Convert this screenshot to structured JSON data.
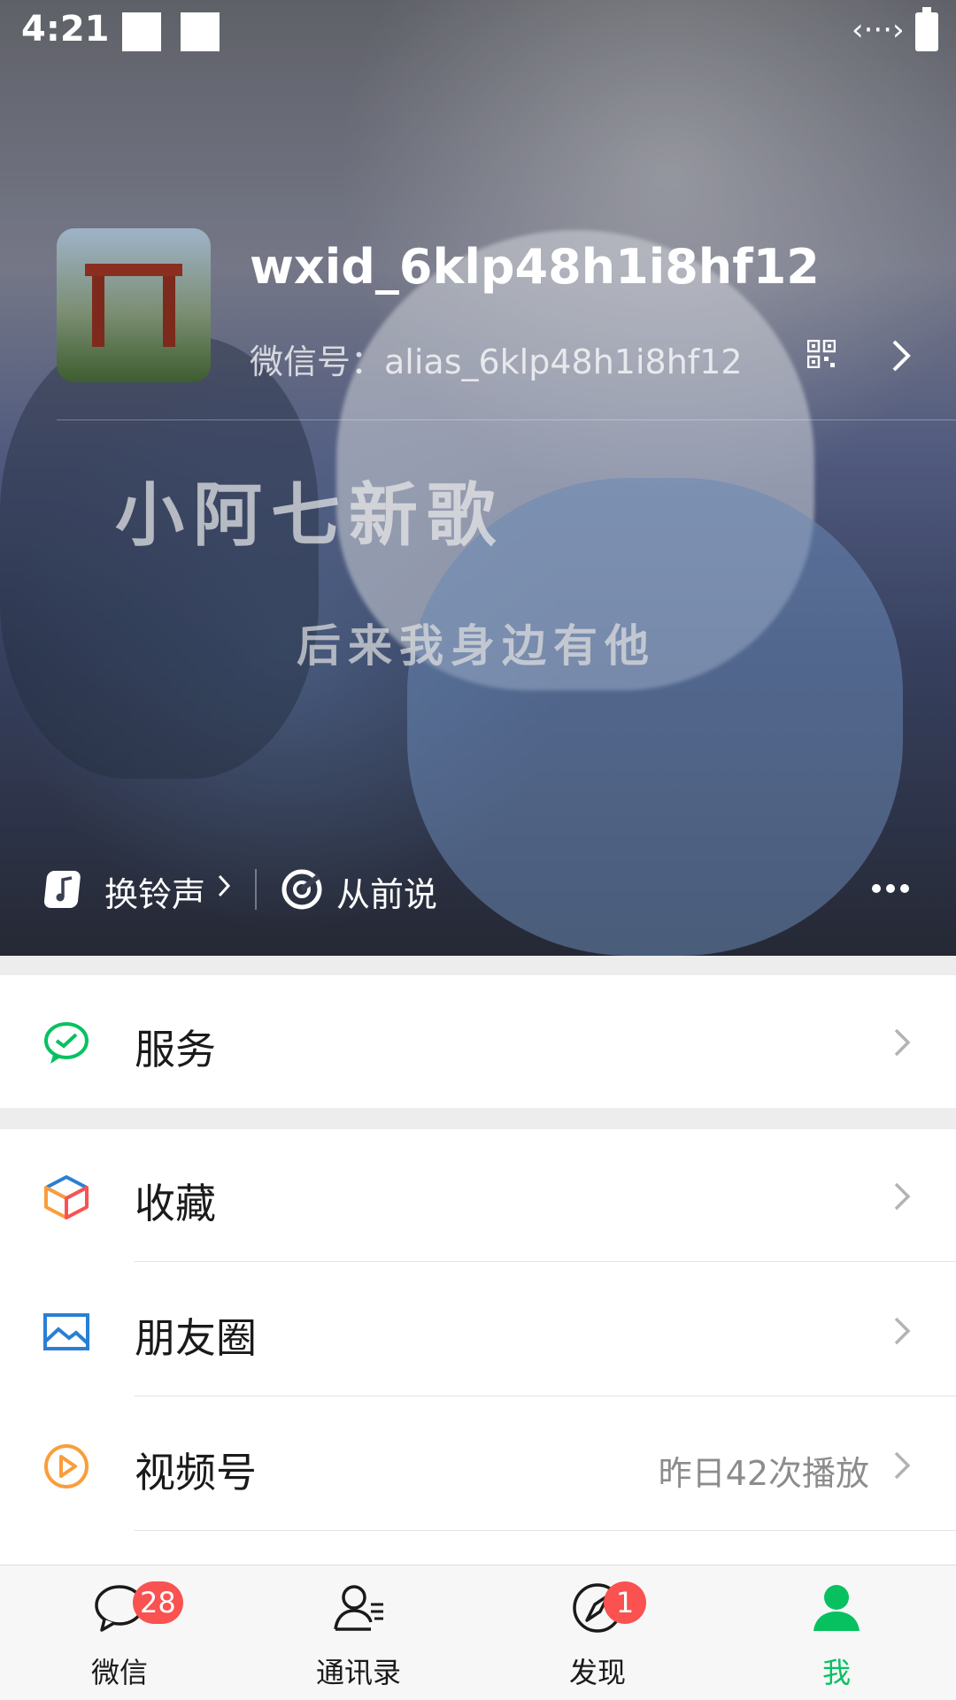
{
  "status_bar": {
    "time": "4:21"
  },
  "profile": {
    "username": "wxid_6klp48h1i8hf12",
    "wechat_id": "微信号：alias_6klp48h1i8hf12"
  },
  "cover_video": {
    "caption_line1": "小阿七新歌",
    "caption_line2": "后来我身边有他"
  },
  "ringtone": {
    "change_label": "换铃声",
    "song_name": "从前说"
  },
  "menu": {
    "service": {
      "label": "服务"
    },
    "favorites": {
      "label": "收藏"
    },
    "moments": {
      "label": "朋友圈"
    },
    "channels": {
      "label": "视频号",
      "detail": "昨日42次播放"
    }
  },
  "tabbar": {
    "tabs": [
      {
        "label": "微信",
        "badge": "28",
        "icon": "chat-bubble-icon"
      },
      {
        "label": "通讯录",
        "icon": "contacts-icon"
      },
      {
        "label": "发现",
        "badge": "1",
        "icon": "compass-icon"
      },
      {
        "label": "我",
        "icon": "person-icon",
        "active": true
      }
    ]
  },
  "colors": {
    "accent_green": "#07c160",
    "badge_red": "#fa5151",
    "orange": "#fa9d3b",
    "blue": "#2a7fd4"
  }
}
